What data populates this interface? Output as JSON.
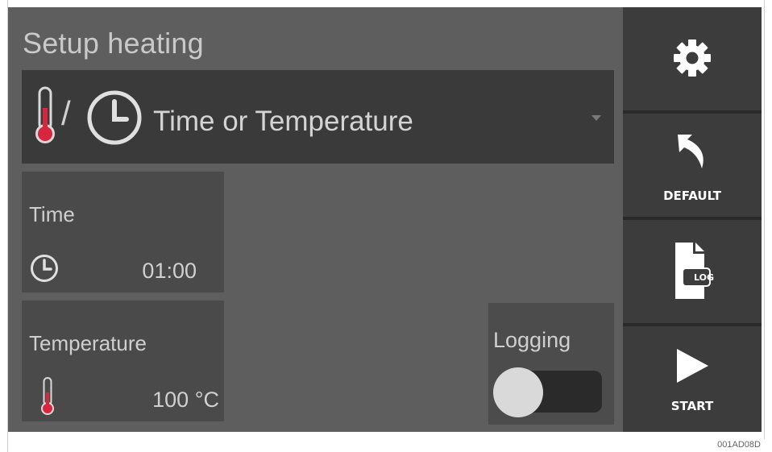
{
  "screen": {
    "title": "Setup heating",
    "mode_select": {
      "selected_label": "Time or Temperature",
      "separator": "/",
      "icons": [
        "thermometer-icon",
        "clock-icon",
        "dropdown-caret-icon"
      ]
    },
    "time_card": {
      "title": "Time",
      "value": "01:00",
      "icon": "clock-icon"
    },
    "temperature_card": {
      "title": "Temperature",
      "value": "100 °C",
      "icon": "thermometer-icon"
    },
    "logging": {
      "label": "Logging",
      "enabled": false
    }
  },
  "sidebar": {
    "settings": {
      "icon": "gear-icon"
    },
    "default": {
      "label": "DEFAULT",
      "icon": "undo-arrow-icon"
    },
    "log": {
      "badge": "LOG",
      "icon": "log-file-icon"
    },
    "start": {
      "label": "START",
      "icon": "play-icon"
    }
  },
  "figure_id": "001AD08D",
  "colors": {
    "screen_bg": "#5e5e5e",
    "panel_bg": "#3a3a3a",
    "card_bg": "#4a4a4a",
    "sidebar_bg": "#292929",
    "thermometer_red": "#d7263d",
    "text": "#d0d0d0"
  }
}
